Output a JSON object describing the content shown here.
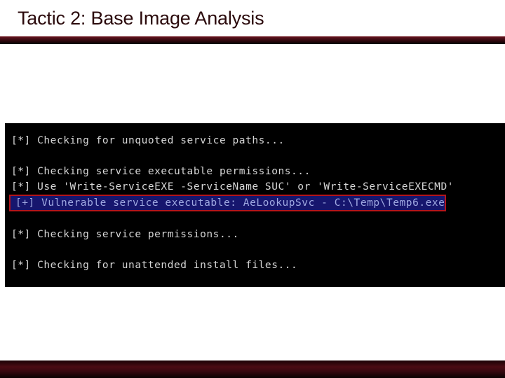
{
  "slide": {
    "title": "Tactic 2: Base Image Analysis",
    "title_color": "#2b0a0c",
    "header_rule_color": "#6d1119",
    "footer_rule_color": "#4a0b13",
    "background_color": "#ffffff"
  },
  "terminal": {
    "background_color": "#000000",
    "text_color": "#d6d6d6",
    "highlight_background_color": "#16166e",
    "highlight_text_color": "#9fa9e2",
    "highlight_border_color": "#b3151c",
    "lines": [
      {
        "text": "[*] Checking for unquoted service paths...",
        "style": "normal"
      },
      {
        "text": "",
        "style": "blank"
      },
      {
        "text": "[*] Checking service executable permissions...",
        "style": "normal"
      },
      {
        "text": "[*] Use 'Write-ServiceEXE -ServiceName SUC' or 'Write-ServiceEXECMD'",
        "style": "normal"
      },
      {
        "text": "[+] Vulnerable service executable: AeLookupSvc - C:\\Temp\\Temp6.exe",
        "style": "highlight"
      },
      {
        "text": "",
        "style": "blank"
      },
      {
        "text": "[*] Checking service permissions...",
        "style": "normal"
      },
      {
        "text": "",
        "style": "blank"
      },
      {
        "text": "[*] Checking for unattended install files...",
        "style": "normal"
      }
    ]
  }
}
